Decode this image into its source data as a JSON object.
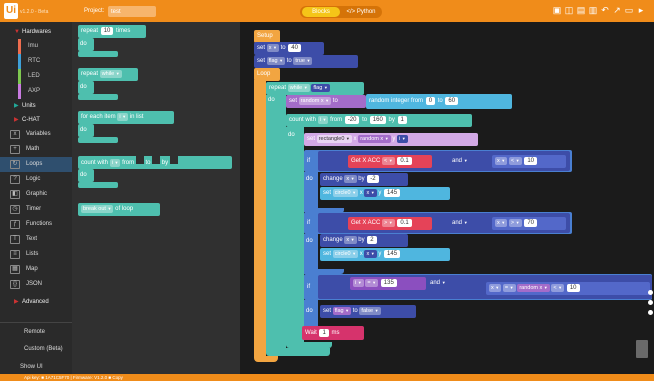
{
  "app": {
    "logo_text": "Ui",
    "version": "v1.2.0 - Beta",
    "project_label": "Project:",
    "project_value": "test"
  },
  "modes": {
    "blocks": "Blocks",
    "python": "</> Python"
  },
  "toolbar_icons": [
    "save-icon",
    "open-icon",
    "download-icon",
    "upload-icon",
    "undo-icon",
    "redo-icon",
    "run-icon",
    "settings-icon"
  ],
  "sidebar": {
    "hardwares": "Hardwares",
    "hw_items": [
      {
        "label": "Imu",
        "color": "#ef6d4f"
      },
      {
        "label": "RTC",
        "color": "#3fa0d8"
      },
      {
        "label": "LED",
        "color": "#7ec850"
      },
      {
        "label": "AXP",
        "color": "#c87be0"
      }
    ],
    "units": "Units",
    "chat": "C-HAT",
    "items": [
      "Variables",
      "Math",
      "Loops",
      "Logic",
      "Graphic",
      "Timer",
      "Functions",
      "Text",
      "Lists",
      "Map",
      "JSON"
    ],
    "selected": "Loops",
    "advanced": "Advanced",
    "remote": "Remote",
    "custom": "Custom (Beta)",
    "show_ui": "Show UI"
  },
  "flyout": {
    "repeat_times": {
      "pre": "repeat",
      "num": "10",
      "post": "times"
    },
    "repeat_while": {
      "pre": "repeat",
      "mode": "while"
    },
    "for_each": {
      "pre": "for each item",
      "var": "i",
      "post": "in list"
    },
    "count_with": {
      "pre": "count with",
      "var": "i",
      "from": "from",
      "to": "to",
      "by": "by"
    },
    "do": "do",
    "break_out": {
      "mode": "break out",
      "post": "of loop"
    }
  },
  "code": {
    "setup": "Setup",
    "set": "set",
    "to": "to",
    "x_var": "x",
    "x_val": "40",
    "flag_var": "flag",
    "flag_val": "true",
    "loop": "Loop",
    "repeat": "repeat",
    "while": "while",
    "do": "do",
    "random_var": "random x",
    "rand_int": "random integer from",
    "rand_from": "0",
    "rand_to": "60",
    "count_with": "count with",
    "i": "i",
    "from": "from",
    "cnt_from": "-20",
    "cnt_to": "160",
    "by": "by",
    "cnt_by": "1",
    "rect": "rectangle0",
    "x_lbl": "x",
    "y_lbl": "y",
    "if": "if",
    "get_acc": "Get X ACC",
    "lt": "<",
    "gt": ">",
    "eq": "=",
    "acc1": "0.1",
    "and": "and",
    "x_cmp1": "10",
    "change": "change",
    "ch1": "-2",
    "circle": "circle0",
    "y_val": "145",
    "x_cmp2": "70",
    "ch2": "2",
    "i_val": "135",
    "rand_cmp": "10",
    "flag_false": "false",
    "wait": "Wait",
    "wait_val": "1",
    "ms": "ms"
  },
  "status": {
    "text": "Api key: ■ 1A71C5F70  |  Firmware: V1.2.0 ■ Copy"
  }
}
